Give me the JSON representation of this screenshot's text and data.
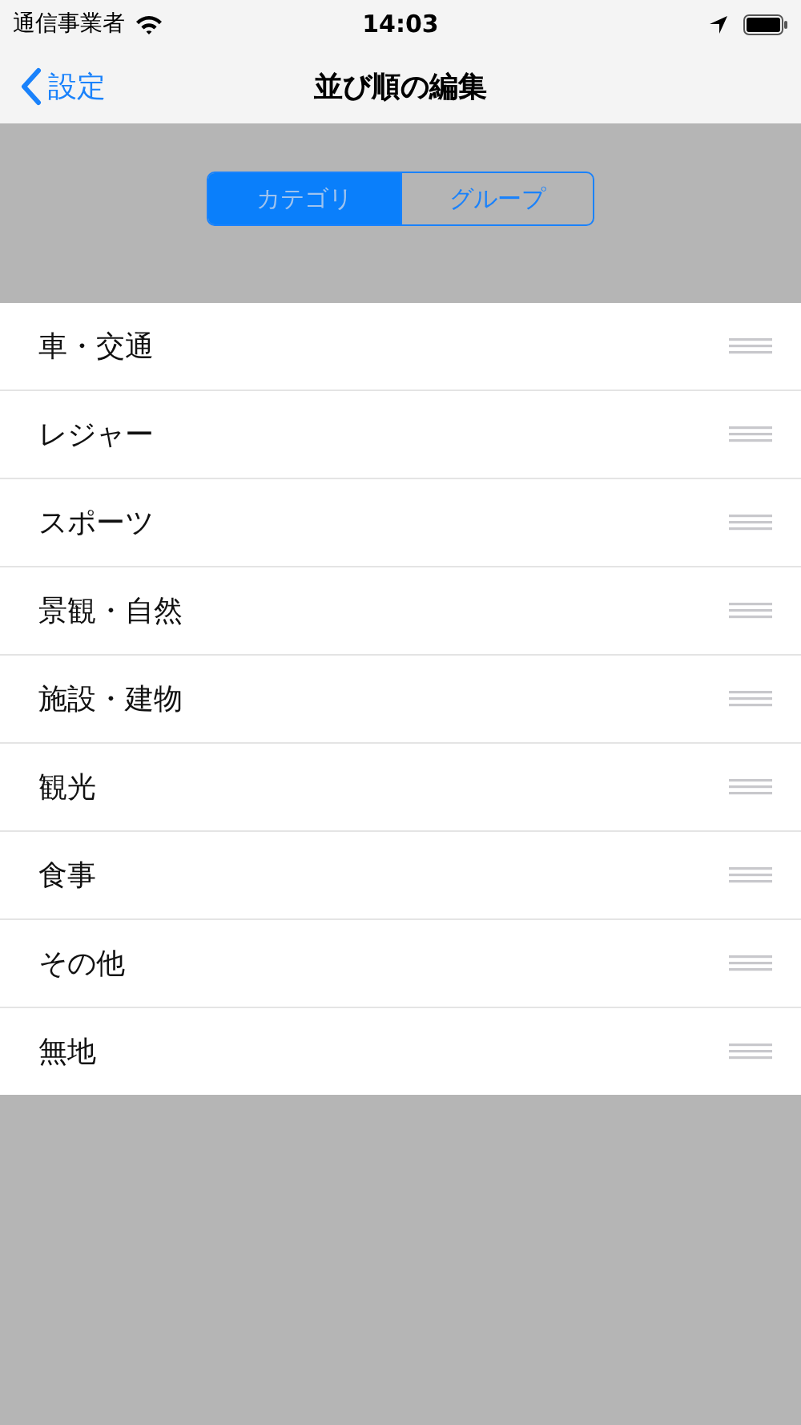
{
  "status_bar": {
    "carrier": "通信事業者",
    "time": "14:03"
  },
  "nav": {
    "back": "設定",
    "title": "並び順の編集"
  },
  "segments": [
    {
      "label": "カテゴリ",
      "selected": true
    },
    {
      "label": "グループ",
      "selected": false
    }
  ],
  "rows": [
    {
      "label": "車・交通"
    },
    {
      "label": "レジャー"
    },
    {
      "label": "スポーツ"
    },
    {
      "label": "景観・自然"
    },
    {
      "label": "施設・建物"
    },
    {
      "label": "観光"
    },
    {
      "label": "食事"
    },
    {
      "label": "その他"
    },
    {
      "label": "無地"
    }
  ]
}
